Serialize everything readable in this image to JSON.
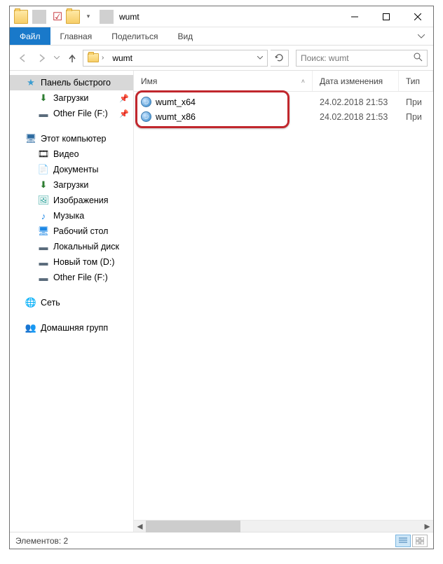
{
  "title": "wumt",
  "ribbon": {
    "file": "Файл",
    "home": "Главная",
    "share": "Поделиться",
    "view": "Вид"
  },
  "address": {
    "folder": "wumt"
  },
  "search": {
    "placeholder": "Поиск: wumt"
  },
  "columns": {
    "name": "Имя",
    "date": "Дата изменения",
    "type": "Тип"
  },
  "files": [
    {
      "name": "wumt_x64",
      "date": "24.02.2018 21:53",
      "type": "При"
    },
    {
      "name": "wumt_x86",
      "date": "24.02.2018 21:53",
      "type": "При"
    }
  ],
  "nav": {
    "quick": "Панель быстрого",
    "quick_items": [
      {
        "label": "Загрузки",
        "icon": "download",
        "pinned": true
      },
      {
        "label": "Other File (F:)",
        "icon": "drive",
        "pinned": true
      }
    ],
    "thispc": "Этот компьютер",
    "pc_items": [
      {
        "label": "Видео",
        "icon": "video"
      },
      {
        "label": "Документы",
        "icon": "doc"
      },
      {
        "label": "Загрузки",
        "icon": "download"
      },
      {
        "label": "Изображения",
        "icon": "image"
      },
      {
        "label": "Музыка",
        "icon": "music"
      },
      {
        "label": "Рабочий стол",
        "icon": "desktop"
      },
      {
        "label": "Локальный диск",
        "icon": "drive"
      },
      {
        "label": "Новый том (D:)",
        "icon": "drive"
      },
      {
        "label": "Other File (F:)",
        "icon": "drive"
      }
    ],
    "network": "Сеть",
    "homegroup": "Домашняя групп"
  },
  "status": {
    "count": "Элементов: 2"
  }
}
